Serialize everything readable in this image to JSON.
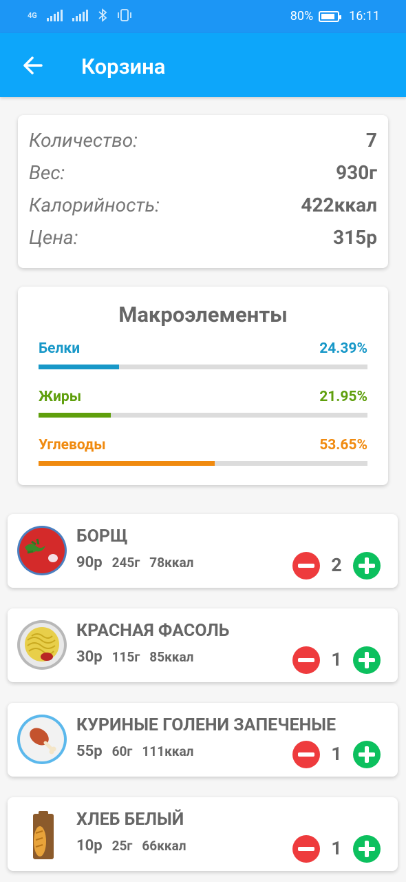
{
  "status": {
    "network": "4G",
    "battery": "80%",
    "time": "16:11"
  },
  "appbar": {
    "title": "Корзина",
    "back_icon": "arrow-left-icon"
  },
  "summary": [
    {
      "label": "Количество:",
      "value": "7"
    },
    {
      "label": "Вес:",
      "value": "930г"
    },
    {
      "label": "Калорийность:",
      "value": "422ккал"
    },
    {
      "label": "Цена:",
      "value": "315р"
    }
  ],
  "macros": {
    "title": "Макроэлементы",
    "items": [
      {
        "name": "Белки",
        "percent": "24.39%",
        "value": 24.39,
        "color": "#1898c8"
      },
      {
        "name": "Жиры",
        "percent": "21.95%",
        "value": 21.95,
        "color": "#5f9f0c"
      },
      {
        "name": "Углеводы",
        "percent": "53.65%",
        "value": 53.65,
        "color": "#f08a0f"
      }
    ]
  },
  "items": [
    {
      "name": "БОРЩ",
      "price": "90р",
      "weight": "245г",
      "kcal": "78ккал",
      "qty": "2",
      "icon": "borscht-icon"
    },
    {
      "name": "КРАСНАЯ ФАСОЛЬ",
      "price": "30р",
      "weight": "115г",
      "kcal": "85ккал",
      "qty": "1",
      "icon": "noodles-icon"
    },
    {
      "name": "КУРИНЫЕ ГОЛЕНИ ЗАПЕЧЕНЫЕ",
      "price": "55р",
      "weight": "60г",
      "kcal": "111ккал",
      "qty": "1",
      "icon": "chicken-leg-icon"
    },
    {
      "name": "ХЛЕБ БЕЛЫЙ",
      "price": "10р",
      "weight": "25г",
      "kcal": "66ккал",
      "qty": "1",
      "icon": "bread-icon"
    }
  ]
}
